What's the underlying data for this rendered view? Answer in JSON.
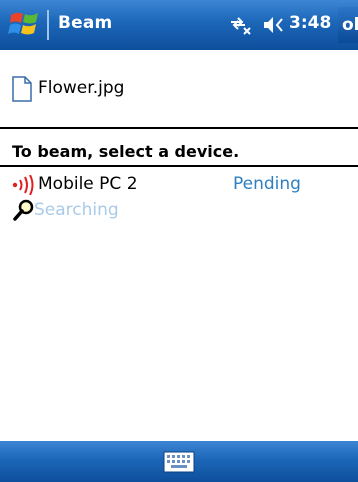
{
  "titlebar": {
    "app_title": "Beam",
    "clock": "3:48",
    "ok_label": "ok",
    "icons": [
      "windows-start-icon",
      "connectivity-icon",
      "volume-icon"
    ]
  },
  "file": {
    "name": "Flower.jpg",
    "icon": "file-icon"
  },
  "instruction": "To beam, select a device.",
  "devices": [
    {
      "name": "Mobile PC 2",
      "status": "Pending",
      "icon": "beam-signal-icon"
    }
  ],
  "search": {
    "label": "Searching",
    "icon": "magnifier-icon"
  },
  "menubar": {
    "icons": [
      "keyboard-icon"
    ]
  },
  "colors": {
    "bar_blue": "#1c66b8",
    "status_blue": "#2f7fc0",
    "searching_text": "#a9cbe8",
    "beam_red": "#e02020"
  }
}
